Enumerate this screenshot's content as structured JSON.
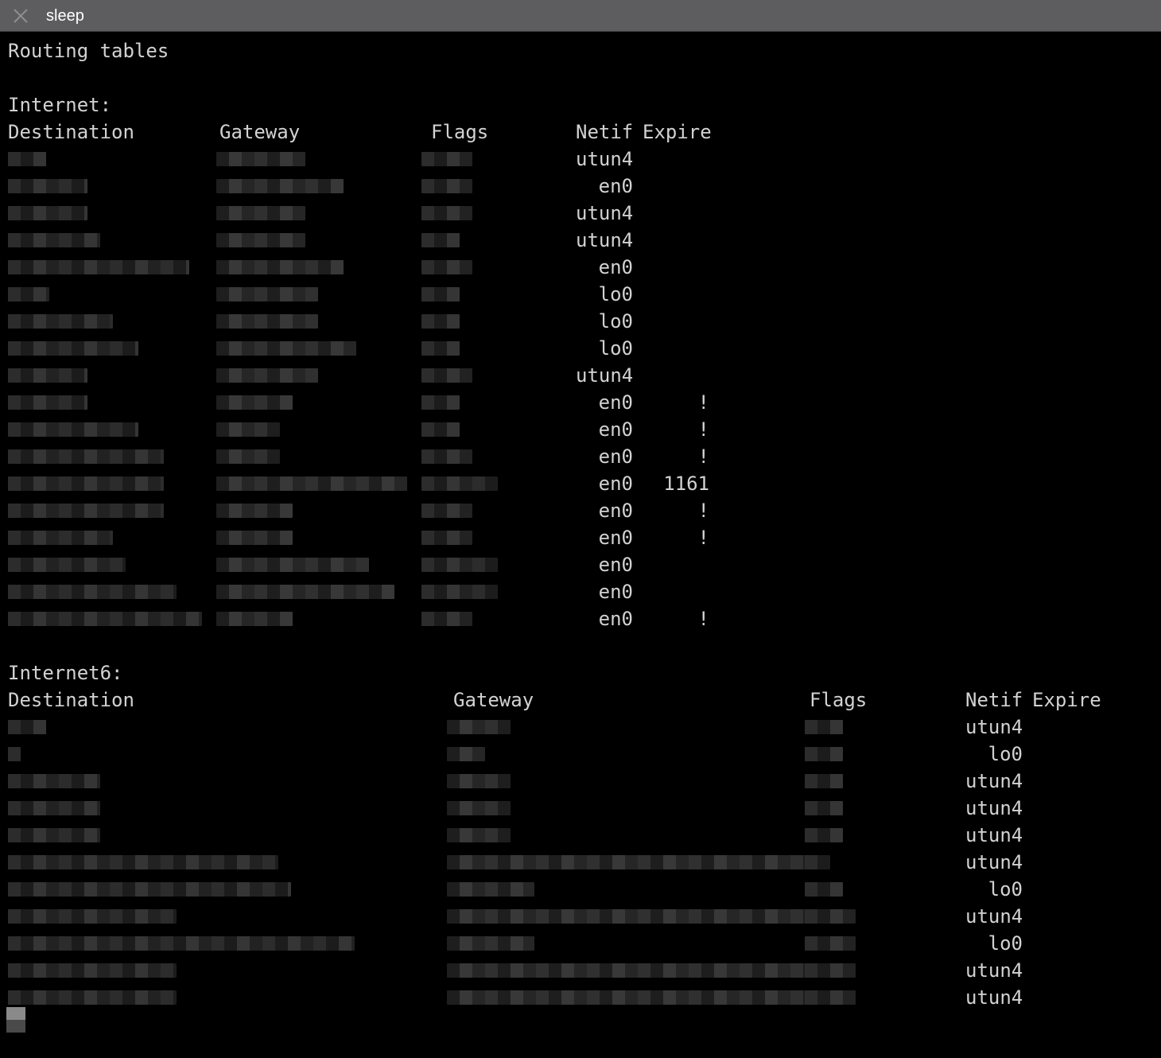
{
  "window": {
    "tab_title": "sleep",
    "close_icon": "close-x-icon"
  },
  "terminal": {
    "heading": "Routing tables",
    "inet": {
      "section_label": "Internet:",
      "headers": {
        "destination": "Destination",
        "gateway": "Gateway",
        "flags": "Flags",
        "netif": "Netif",
        "expire": "Expire"
      },
      "rows": [
        {
          "netif": "utun4",
          "expire": ""
        },
        {
          "netif": "en0",
          "expire": ""
        },
        {
          "netif": "utun4",
          "expire": ""
        },
        {
          "netif": "utun4",
          "expire": ""
        },
        {
          "netif": "en0",
          "expire": ""
        },
        {
          "netif": "lo0",
          "expire": ""
        },
        {
          "netif": "lo0",
          "expire": ""
        },
        {
          "netif": "lo0",
          "expire": ""
        },
        {
          "netif": "utun4",
          "expire": ""
        },
        {
          "netif": "en0",
          "expire": "!"
        },
        {
          "netif": "en0",
          "expire": "!"
        },
        {
          "netif": "en0",
          "expire": "!"
        },
        {
          "netif": "en0",
          "expire": "1161"
        },
        {
          "netif": "en0",
          "expire": "!"
        },
        {
          "netif": "en0",
          "expire": "!"
        },
        {
          "netif": "en0",
          "expire": ""
        },
        {
          "netif": "en0",
          "expire": ""
        },
        {
          "netif": "en0",
          "expire": "!"
        }
      ]
    },
    "inet6": {
      "section_label": "Internet6:",
      "headers": {
        "destination": "Destination",
        "gateway": "Gateway",
        "flags": "Flags",
        "netif": "Netif",
        "expire": "Expire"
      },
      "rows": [
        {
          "netif": "utun4"
        },
        {
          "netif": "lo0"
        },
        {
          "netif": "utun4"
        },
        {
          "netif": "utun4"
        },
        {
          "netif": "utun4"
        },
        {
          "netif": "utun4"
        },
        {
          "netif": "lo0"
        },
        {
          "netif": "utun4"
        },
        {
          "netif": "lo0"
        },
        {
          "netif": "utun4"
        },
        {
          "netif": "utun4"
        }
      ]
    }
  },
  "colors": {
    "titlebar": "#5d5d5f",
    "background": "#000000",
    "text": "#d2d2d2"
  }
}
